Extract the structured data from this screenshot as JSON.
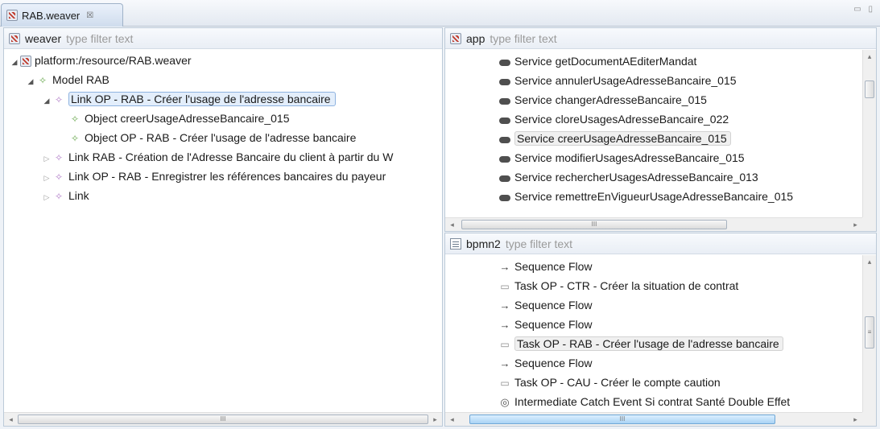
{
  "editor": {
    "tab_title": "RAB.weaver",
    "tab_close": "☒",
    "window_controls": "▭ ▯"
  },
  "weaver": {
    "name": "weaver",
    "filter_placeholder": "type filter text",
    "tree": [
      {
        "label": "platform:/resource/RAB.weaver",
        "icon": "weaver-file-icon",
        "expander": "◢",
        "state": "normal"
      },
      {
        "label": "Model RAB",
        "icon": "model-icon",
        "glyph": "✧",
        "expander": "◢",
        "state": "normal"
      },
      {
        "label": "Link OP - RAB - Créer l'usage de l'adresse bancaire",
        "icon": "link-icon",
        "glyph": "✧",
        "expander": "◢",
        "state": "selected"
      },
      {
        "label": "Object creerUsageAdresseBancaire_015",
        "icon": "object-icon",
        "glyph": "✧",
        "expander": "",
        "state": "normal"
      },
      {
        "label": "Object OP - RAB - Créer l'usage de l'adresse bancaire",
        "icon": "object-icon",
        "glyph": "✧",
        "expander": "",
        "state": "normal"
      },
      {
        "label": "Link RAB - Création de l'Adresse Bancaire du client à partir du W",
        "icon": "link-icon",
        "glyph": "✧",
        "expander": "▷",
        "state": "normal"
      },
      {
        "label": "Link OP - RAB - Enregistrer les références bancaires du payeur",
        "icon": "link-icon",
        "glyph": "✧",
        "expander": "▷",
        "state": "normal"
      },
      {
        "label": "Link",
        "icon": "link-icon",
        "glyph": "✧",
        "expander": "▷",
        "state": "normal"
      }
    ],
    "scroll_thumb": "III"
  },
  "app": {
    "name": "app",
    "filter_placeholder": "type filter text",
    "items": [
      {
        "label": "Service getDocumentAEditerMandat",
        "state": "normal"
      },
      {
        "label": "Service annulerUsageAdresseBancaire_015",
        "state": "normal"
      },
      {
        "label": "Service changerAdresseBancaire_015",
        "state": "normal"
      },
      {
        "label": "Service cloreUsagesAdresseBancaire_022",
        "state": "normal"
      },
      {
        "label": "Service creerUsageAdresseBancaire_015",
        "state": "highlighted"
      },
      {
        "label": "Service modifierUsagesAdresseBancaire_015",
        "state": "normal"
      },
      {
        "label": "Service rechercherUsagesAdresseBancaire_013",
        "state": "normal"
      },
      {
        "label": "Service remettreEnVigueurUsageAdresseBancaire_015",
        "state": "normal"
      }
    ],
    "scroll_thumb": "III"
  },
  "bpmn2": {
    "name": "bpmn2",
    "filter_placeholder": "type filter text",
    "items": [
      {
        "label": "Sequence Flow",
        "icon": "arrow-icon",
        "glyph": "→",
        "state": "normal"
      },
      {
        "label": "Task OP - CTR - Créer la situation de contrat",
        "icon": "task-icon",
        "glyph": "▭",
        "state": "normal"
      },
      {
        "label": "Sequence Flow",
        "icon": "arrow-icon",
        "glyph": "→",
        "state": "normal"
      },
      {
        "label": "Sequence Flow",
        "icon": "arrow-icon",
        "glyph": "→",
        "state": "normal"
      },
      {
        "label": "Task OP - RAB - Créer l'usage de l'adresse bancaire",
        "icon": "task-icon",
        "glyph": "▭",
        "state": "highlighted"
      },
      {
        "label": "Sequence Flow",
        "icon": "arrow-icon",
        "glyph": "→",
        "state": "normal"
      },
      {
        "label": "Task OP - CAU - Créer le compte caution",
        "icon": "task-icon",
        "glyph": "▭",
        "state": "normal"
      },
      {
        "label": "Intermediate Catch Event Si contrat Santé Double Effet",
        "icon": "event-icon",
        "glyph": "◎",
        "state": "normal"
      }
    ],
    "scroll_thumb": "III",
    "vscroll_grip": "≡"
  }
}
